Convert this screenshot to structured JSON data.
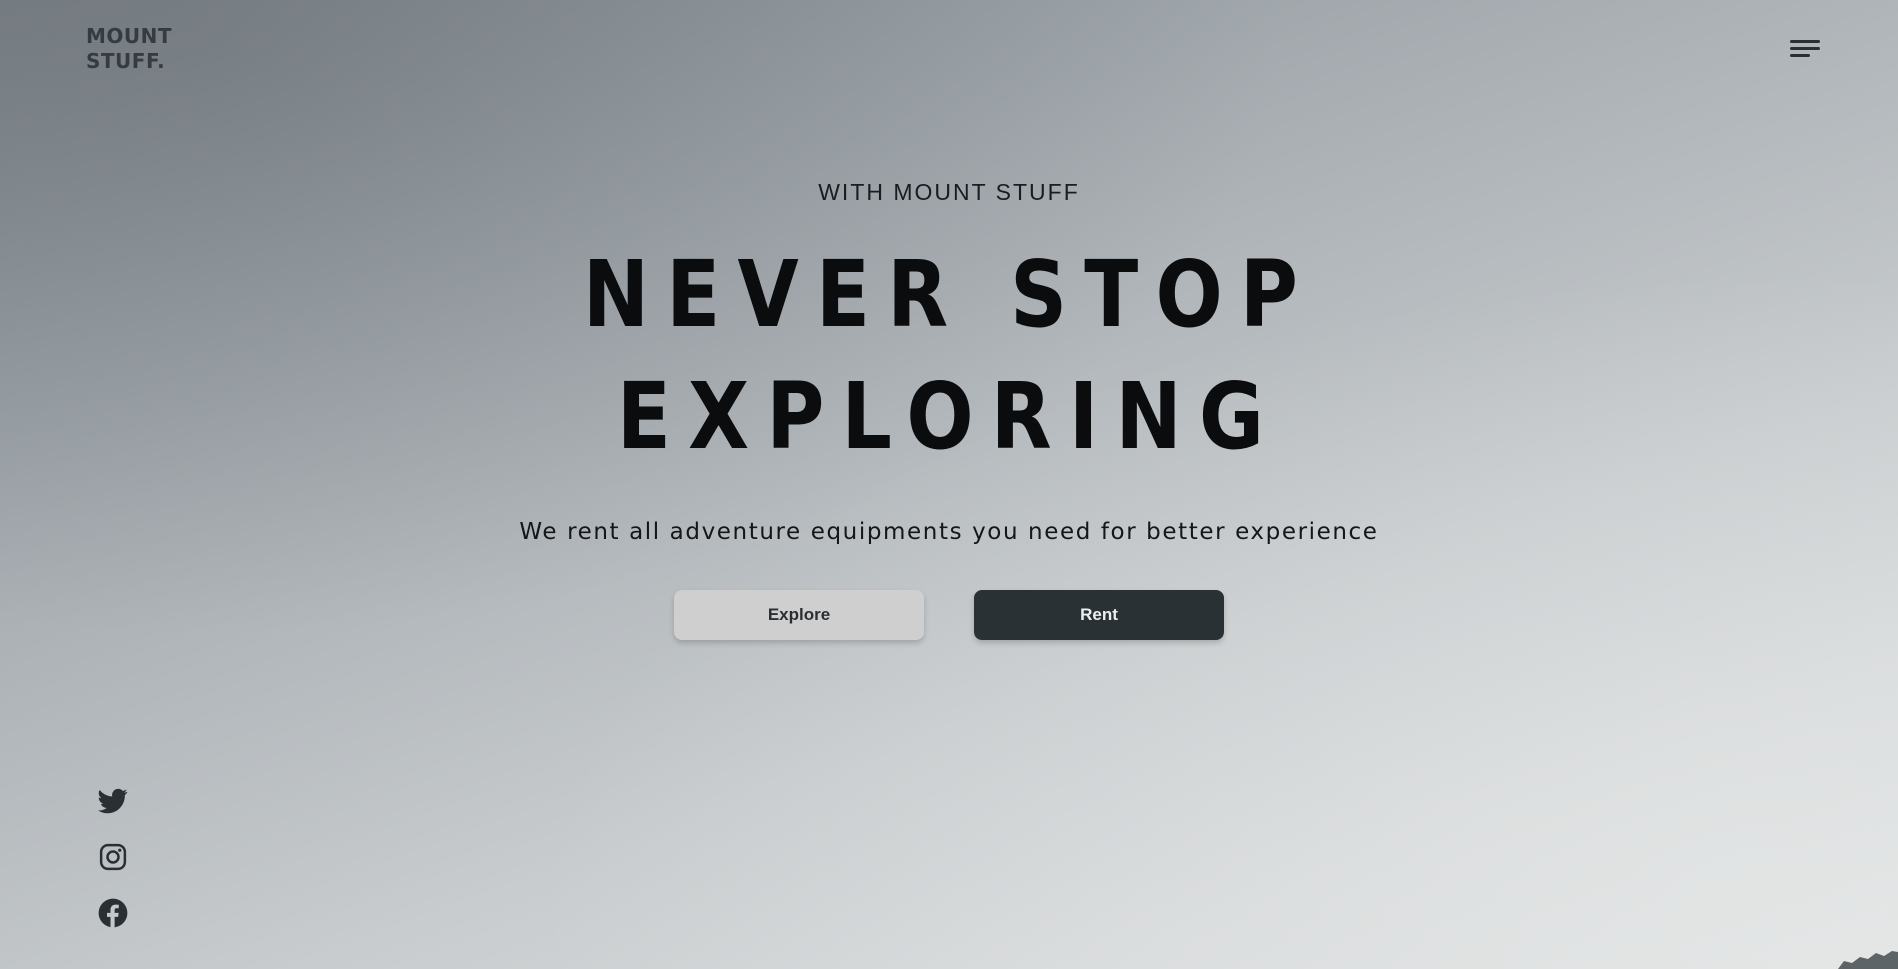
{
  "brand": {
    "line1": "MOUNT",
    "line2": "STUFF."
  },
  "header": {
    "menu_icon": "hamburger-menu-icon"
  },
  "hero": {
    "eyebrow": "WITH MOUNT STUFF",
    "headline_line1": "NEVER STOP",
    "headline_line2": "EXPLORING",
    "tagline": "We rent all adventure equipments you need for better experience",
    "explore_label": "Explore",
    "rent_label": "Rent"
  },
  "social": {
    "items": [
      {
        "icon": "twitter-icon"
      },
      {
        "icon": "instagram-icon"
      },
      {
        "icon": "facebook-icon"
      }
    ]
  },
  "colors": {
    "text_dark": "#0b0c0d",
    "button_light": "#cfcfcf",
    "button_dark": "#2a3135"
  }
}
